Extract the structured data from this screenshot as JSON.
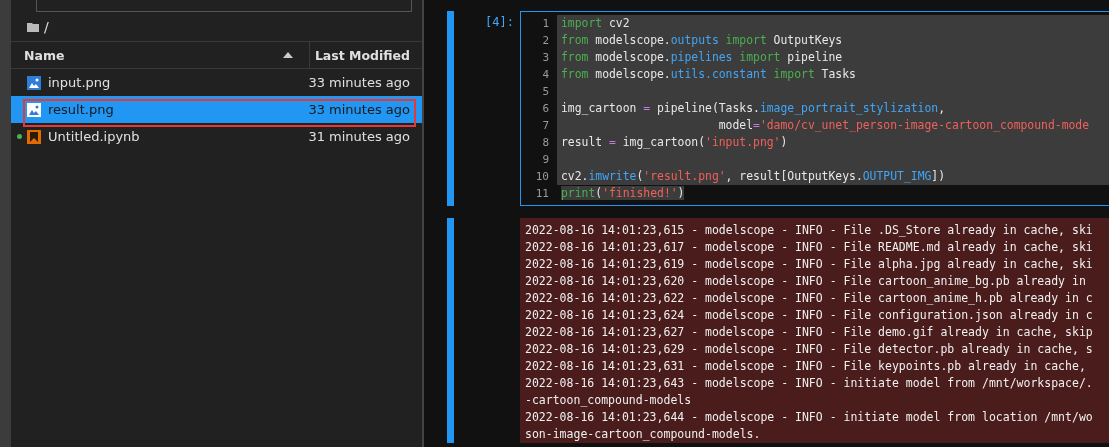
{
  "file_browser": {
    "path": "/",
    "columns": [
      {
        "label": "Name",
        "sorted": true
      },
      {
        "label": "Last Modified",
        "sorted": false
      }
    ],
    "files": [
      {
        "name": "input.png",
        "kind": "image",
        "modified": "33 minutes ago",
        "selected": false,
        "running": false,
        "annotated": false
      },
      {
        "name": "result.png",
        "kind": "image",
        "modified": "33 minutes ago",
        "selected": true,
        "running": false,
        "annotated": true
      },
      {
        "name": "Untitled.ipynb",
        "kind": "notebook",
        "modified": "31 minutes ago",
        "selected": false,
        "running": true,
        "annotated": false
      }
    ]
  },
  "cell": {
    "prompt": "[4]:",
    "active": true,
    "lines": [
      {
        "number": "1",
        "selected": true,
        "partial": false,
        "tokens": [
          {
            "kind": "keyword",
            "text": "import"
          },
          {
            "kind": "plain",
            "text": " cv2"
          }
        ]
      },
      {
        "number": "2",
        "selected": true,
        "partial": false,
        "tokens": [
          {
            "kind": "keyword",
            "text": "from"
          },
          {
            "kind": "plain",
            "text": " modelscope."
          },
          {
            "kind": "attr",
            "text": "outputs"
          },
          {
            "kind": "keyword",
            "text": " import"
          },
          {
            "kind": "plain",
            "text": " OutputKeys"
          }
        ]
      },
      {
        "number": "3",
        "selected": true,
        "partial": false,
        "tokens": [
          {
            "kind": "keyword",
            "text": "from"
          },
          {
            "kind": "plain",
            "text": " modelscope."
          },
          {
            "kind": "attr",
            "text": "pipelines"
          },
          {
            "kind": "keyword",
            "text": " import"
          },
          {
            "kind": "plain",
            "text": " pipeline"
          }
        ]
      },
      {
        "number": "4",
        "selected": true,
        "partial": false,
        "tokens": [
          {
            "kind": "keyword",
            "text": "from"
          },
          {
            "kind": "plain",
            "text": " modelscope."
          },
          {
            "kind": "attr",
            "text": "utils.constant"
          },
          {
            "kind": "keyword",
            "text": " import"
          },
          {
            "kind": "plain",
            "text": " Tasks"
          }
        ]
      },
      {
        "number": "5",
        "selected": true,
        "partial": false
      },
      {
        "number": "6",
        "selected": true,
        "partial": false,
        "tokens": [
          {
            "kind": "plain",
            "text": "img_cartoon "
          },
          {
            "kind": "operator",
            "text": "="
          },
          {
            "kind": "plain",
            "text": " pipeline(Tasks."
          },
          {
            "kind": "attr",
            "text": "image_portrait_stylization"
          },
          {
            "kind": "plain",
            "text": ","
          }
        ]
      },
      {
        "number": "7",
        "selected": true,
        "partial": false,
        "tokens": [
          {
            "kind": "plain",
            "text": "                       model"
          },
          {
            "kind": "operator",
            "text": "="
          },
          {
            "kind": "string",
            "text": "'damo/cv_unet_person-image-cartoon_compound-mode"
          }
        ]
      },
      {
        "number": "8",
        "selected": true,
        "partial": false,
        "tokens": [
          {
            "kind": "plain",
            "text": "result "
          },
          {
            "kind": "operator",
            "text": "="
          },
          {
            "kind": "plain",
            "text": " img_cartoon("
          },
          {
            "kind": "string",
            "text": "'input.png'"
          },
          {
            "kind": "plain",
            "text": ")"
          }
        ]
      },
      {
        "number": "9",
        "selected": true,
        "partial": false
      },
      {
        "number": "10",
        "selected": true,
        "partial": false,
        "tokens": [
          {
            "kind": "plain",
            "text": "cv2."
          },
          {
            "kind": "attr",
            "text": "imwrite"
          },
          {
            "kind": "plain",
            "text": "("
          },
          {
            "kind": "string",
            "text": "'result.png'"
          },
          {
            "kind": "plain",
            "text": ", result[OutputKeys."
          },
          {
            "kind": "attr",
            "text": "OUTPUT_IMG"
          },
          {
            "kind": "plain",
            "text": "])"
          }
        ]
      },
      {
        "number": "11",
        "selected": true,
        "partial": true,
        "tokens": [
          {
            "kind": "keyword",
            "text": "print"
          },
          {
            "kind": "plain",
            "text": "("
          },
          {
            "kind": "string",
            "text": "'finished!'"
          },
          {
            "kind": "plain",
            "text": ")"
          }
        ]
      }
    ],
    "output": [
      "2022-08-16 14:01:23,615 - modelscope - INFO - File .DS_Store already in cache, ski",
      "2022-08-16 14:01:23,617 - modelscope - INFO - File README.md already in cache, ski",
      "2022-08-16 14:01:23,619 - modelscope - INFO - File alpha.jpg already in cache, ski",
      "2022-08-16 14:01:23,620 - modelscope - INFO - File cartoon_anime_bg.pb already in",
      "2022-08-16 14:01:23,622 - modelscope - INFO - File cartoon_anime_h.pb already in c",
      "2022-08-16 14:01:23,624 - modelscope - INFO - File configuration.json already in c",
      "2022-08-16 14:01:23,627 - modelscope - INFO - File demo.gif already in cache, skip",
      "2022-08-16 14:01:23,629 - modelscope - INFO - File detector.pb already in cache, s",
      "2022-08-16 14:01:23,631 - modelscope - INFO - File keypoints.pb already in cache,",
      "2022-08-16 14:01:23,643 - modelscope - INFO - initiate model from /mnt/workspace/.",
      "-cartoon_compound-models",
      "2022-08-16 14:01:23,644 - modelscope - INFO - initiate model from location /mnt/wo",
      "son-image-cartoon_compound-models."
    ]
  }
}
